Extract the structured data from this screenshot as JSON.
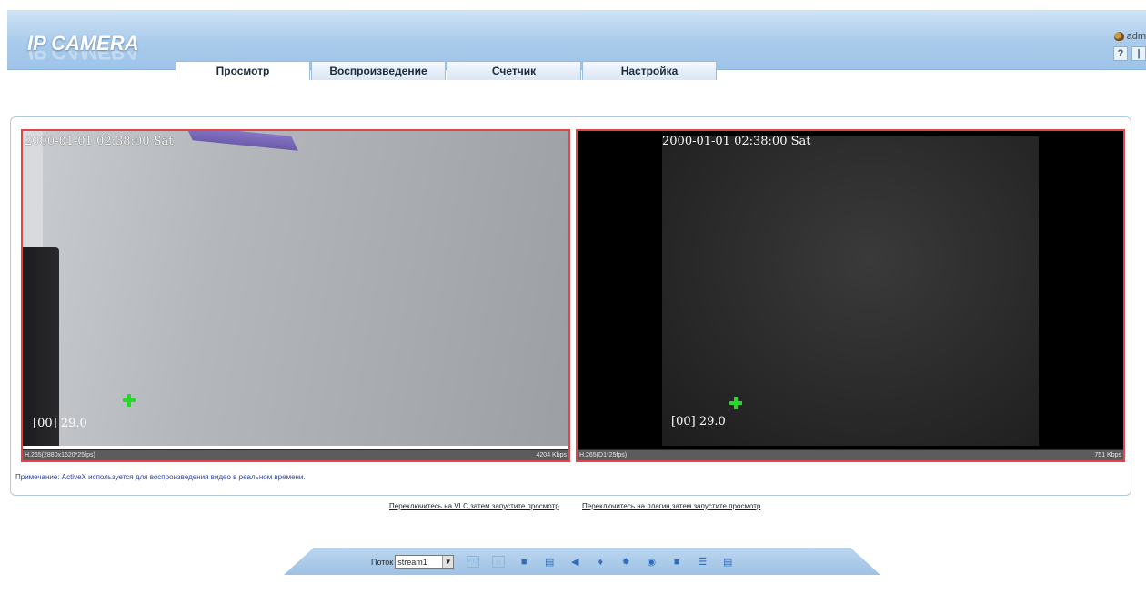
{
  "header": {
    "logo_text": "IP CAMERA",
    "user_text": "adm",
    "tabs": [
      {
        "label": "Просмотр",
        "active": true
      },
      {
        "label": "Воспроизведение",
        "active": false
      },
      {
        "label": "Счетчик",
        "active": false
      },
      {
        "label": "Настройка",
        "active": false
      }
    ]
  },
  "videos": [
    {
      "timestamp": "2000-01-01 02:38:00 Sat",
      "osd_fps": "[00] 29.0",
      "codec_info": "H.265(2880x1620*25fps)",
      "bitrate": "4204 Kbps"
    },
    {
      "timestamp": "2000-01-01 02:38:00 Sat",
      "osd_fps": "[00] 29.0",
      "codec_info": "H.265(D1*25fps)",
      "bitrate": "751 Kbps"
    }
  ],
  "note": "Примечание: ActiveX используется для воспроизведения видео в реальном времени.",
  "links": {
    "vlc": "Переключитесь на VLC,затем запустите просмотр",
    "plugin": "Переключитесь на плагин,затем запустите просмотр"
  },
  "toolbar": {
    "stream_label": "Поток",
    "stream_value": "stream1",
    "icons": [
      "ptz-icon",
      "fullscreen-icon",
      "stop-icon",
      "record-off-icon",
      "audio-mute-icon",
      "mic-mute-icon",
      "settings-icon",
      "snapshot-icon",
      "video-record-icon",
      "list-icon",
      "alarm-off-icon"
    ]
  }
}
